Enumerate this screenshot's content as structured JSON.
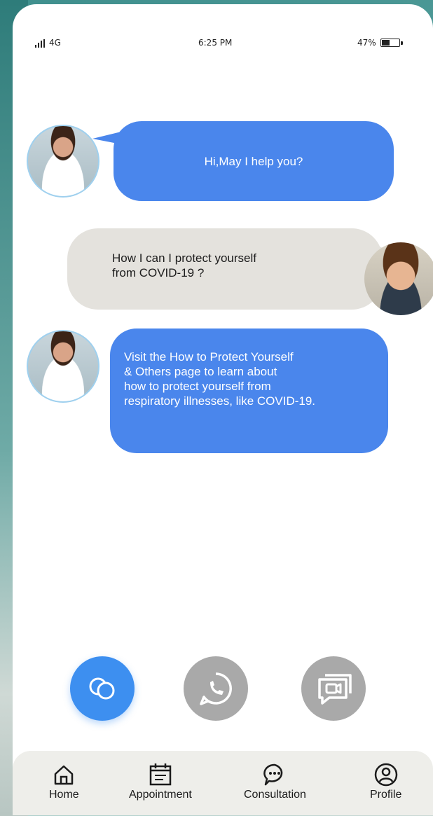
{
  "status_bar": {
    "network": "4G",
    "time": "6:25 PM",
    "battery": "47%",
    "battery_level": 0.47
  },
  "chat": {
    "messages": [
      {
        "sender": "assistant",
        "text": "Hi,May I help you?"
      },
      {
        "sender": "user",
        "lines": [
          "How I can I protect yourself",
          "from COVID-19 ?"
        ]
      },
      {
        "sender": "assistant",
        "lines": [
          "Visit the How to Protect Yourself",
          "& Others page to learn about",
          "how to protect yourself from",
          "respiratory illnesses, like COVID-19."
        ]
      }
    ]
  },
  "action_buttons": [
    {
      "icon": "chat-bubbles-icon",
      "active": true
    },
    {
      "icon": "phone-call-icon",
      "active": false
    },
    {
      "icon": "video-call-icon",
      "active": false
    }
  ],
  "tab_bar": {
    "tabs": [
      {
        "label": "Home",
        "icon": "home-icon"
      },
      {
        "label": "Appointment",
        "icon": "calendar-icon"
      },
      {
        "label": "Consultation",
        "icon": "chat-icon"
      },
      {
        "label": "Profile",
        "icon": "user-icon"
      }
    ]
  },
  "colors": {
    "accent": "#3d8ff0",
    "bot_bubble": "#4a86ec",
    "user_bubble": "#e4e2dd",
    "inactive_button": "#a9a9a9",
    "tab_bar_bg": "#eeeeea"
  }
}
